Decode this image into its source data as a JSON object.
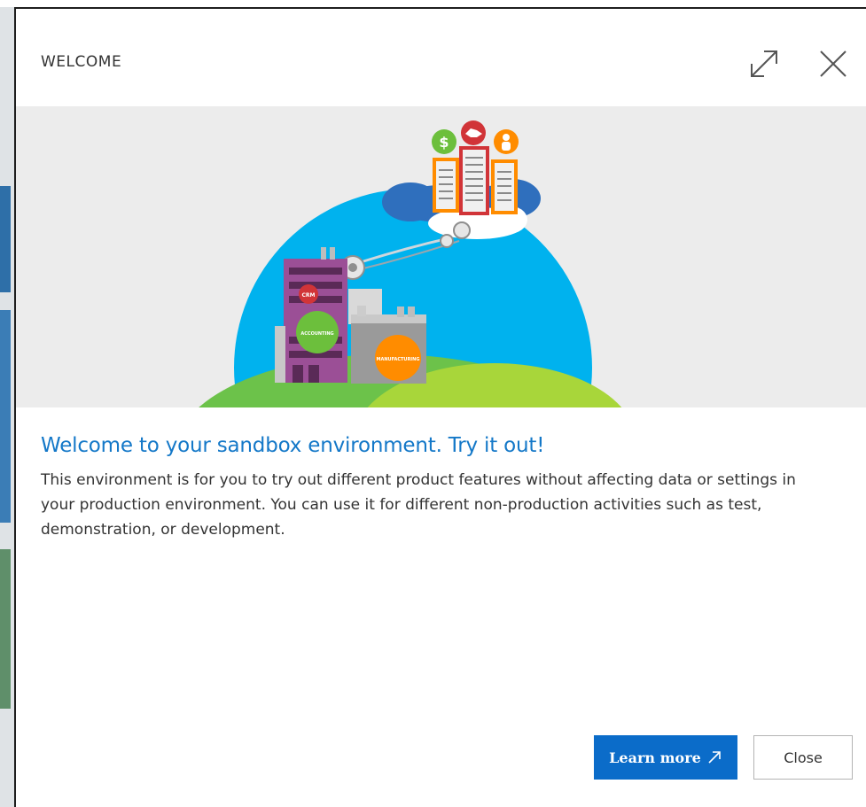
{
  "dialog": {
    "title": "WELCOME",
    "heading": "Welcome to your sandbox environment. Try it out!",
    "body": "This environment is for you to try out different product features without affecting data or settings in your production environment. You can use it for different non-production activities such as test, demonstration, or development.",
    "learn_more_label": "Learn more",
    "close_label": "Close"
  },
  "illustration": {
    "crm_label": "CRM",
    "accounting_label": "ACCOUNTING",
    "manufacturing_label": "MANUFACTURING"
  },
  "icons": {
    "expand": "expand-icon",
    "close": "close-icon",
    "external_link": "external-link-icon"
  },
  "colors": {
    "accent": "#0b6cc9",
    "heading": "#1478c8",
    "sky": "#00b2ee",
    "banner_bg": "#ececec"
  }
}
